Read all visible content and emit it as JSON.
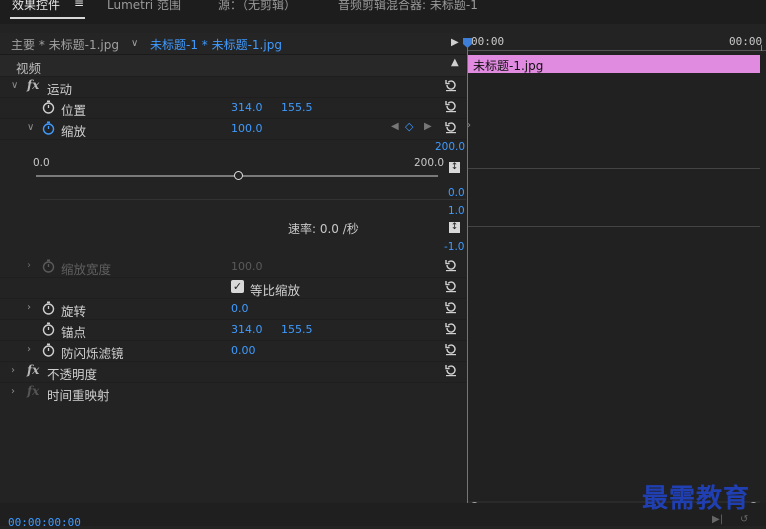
{
  "tabs": [
    {
      "label": "效果控件",
      "active": true
    },
    {
      "label": "≡",
      "active": true
    },
    {
      "label": "Lumetri 范围",
      "active": false
    },
    {
      "label": "源：（无剪辑）",
      "active": false
    },
    {
      "label": "音频剪辑混合器: 未标题-1",
      "active": false
    }
  ],
  "header": {
    "master": "主要 * 未标题-1.jpg",
    "sequence": "未标题-1 * 未标题-1.jpg",
    "play_icon": "play-triangle-icon"
  },
  "ruler": {
    "start": "00:00",
    "end": "00:00"
  },
  "clip": {
    "label": "未标题-1.jpg",
    "color": "#e08ae0"
  },
  "section_video": "视频",
  "effects": {
    "motion": "运动",
    "position": {
      "label": "位置",
      "x": "314.0",
      "y": "155.5"
    },
    "scale": {
      "label": "缩放",
      "value": "100.0"
    },
    "scale_graph": {
      "min": "0.0",
      "max": "200.0",
      "top": "200.0",
      "bottom": "0.0",
      "speed_top": "1.0",
      "speed_bottom": "-1.0",
      "rate": "速率: 0.0 /秒"
    },
    "scale_width": {
      "label": "缩放宽度",
      "value": "100.0"
    },
    "uniform": {
      "label": "等比缩放",
      "checked": true
    },
    "rotation": {
      "label": "旋转",
      "value": "0.0"
    },
    "anchor": {
      "label": "锚点",
      "x": "314.0",
      "y": "155.5"
    },
    "flicker": {
      "label": "防闪烁滤镜",
      "value": "0.00"
    },
    "opacity": "不透明度",
    "time_remap": "时间重映射"
  },
  "timecode": "00:00:00:00",
  "watermark": "最需教育",
  "colors": {
    "accent": "#3f9bff",
    "playhead": "#3d7ed8",
    "clip": "#e08ae0"
  }
}
